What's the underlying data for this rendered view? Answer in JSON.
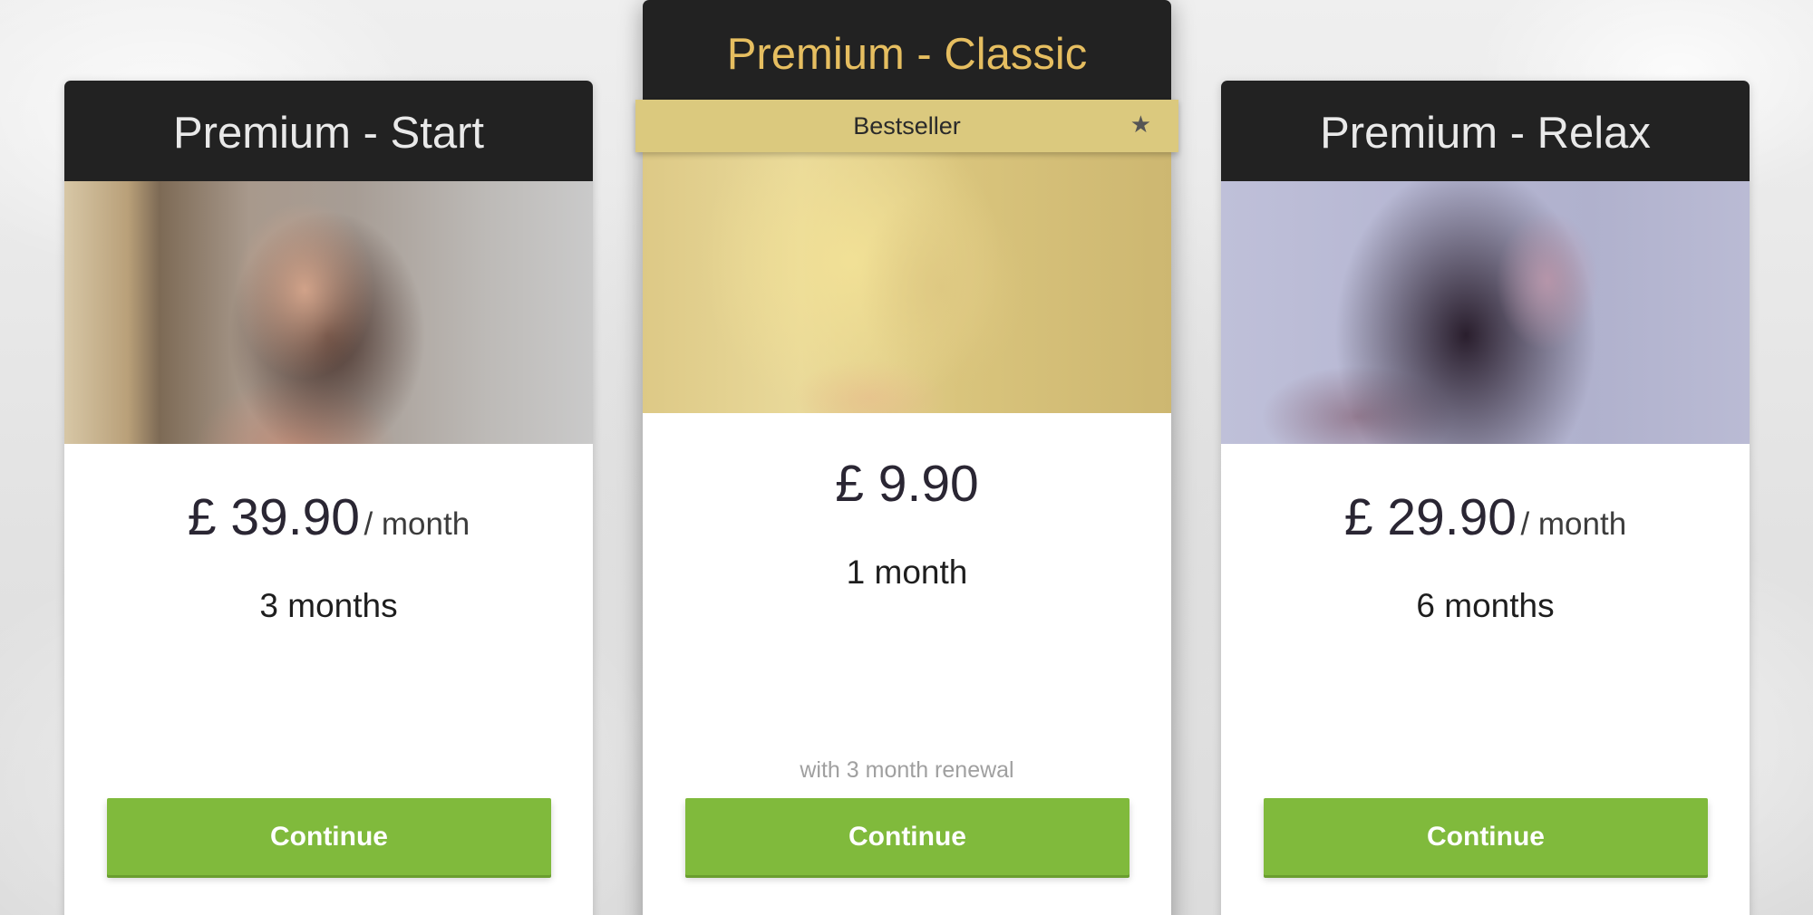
{
  "plans": [
    {
      "title": "Premium - Start",
      "price": "£ 39.90",
      "per": "/ month",
      "duration": "3 months",
      "button_label": "Continue"
    },
    {
      "title": "Premium - Classic",
      "ribbon_label": "Bestseller",
      "ribbon_icon": "star-icon",
      "price": "£ 9.90",
      "duration": "1 month",
      "note": "with 3 month renewal",
      "button_label": "Continue"
    },
    {
      "title": "Premium - Relax",
      "price": "£ 29.90",
      "per": "/ month",
      "duration": "6 months",
      "button_label": "Continue"
    }
  ],
  "colors": {
    "header_bg": "#222222",
    "featured_title": "#e6be60",
    "ribbon_bg": "#dbc97e",
    "button_bg": "#80ba3c"
  }
}
